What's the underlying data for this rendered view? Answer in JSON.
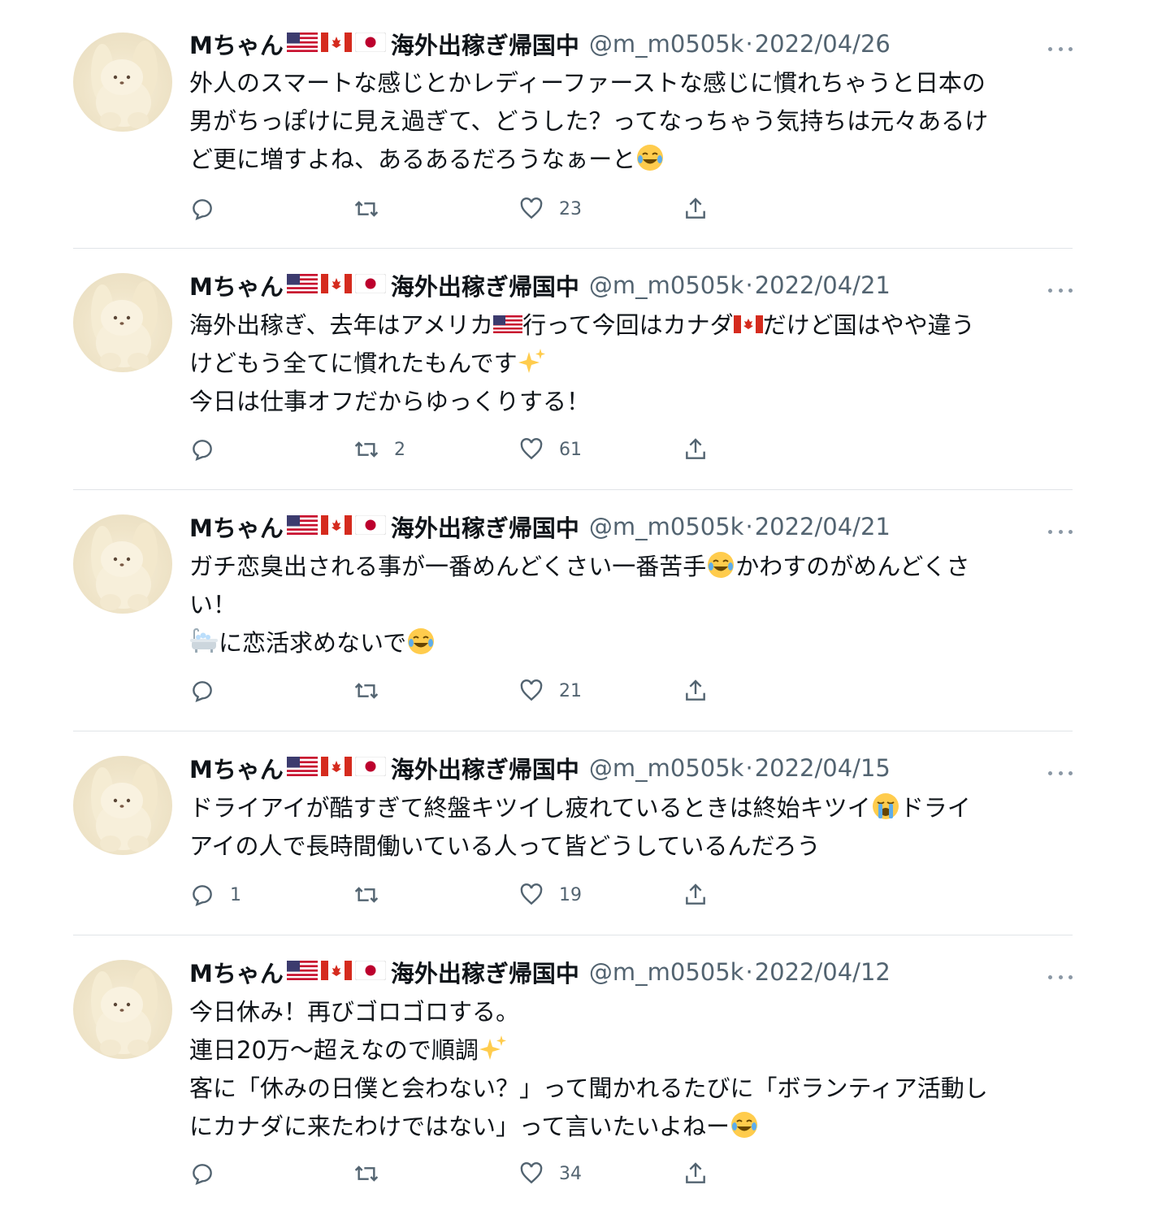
{
  "colors": {
    "text": "#0f1419",
    "secondary": "#536471",
    "divider": "#e1e4e8",
    "icon": "#536471"
  },
  "icons": {
    "reply": "speech-bubble-icon",
    "retweet": "retweet-icon",
    "like": "heart-icon",
    "share": "share-upload-icon",
    "more": "three-dots-icon",
    "flags": [
      "us-flag-icon",
      "canada-flag-icon",
      "japan-flag-icon"
    ]
  },
  "user": {
    "name_prefix": "Mちゃん",
    "name_suffix": "海外出稼ぎ帰国中",
    "handle": "@m_m0505k",
    "separator": "·"
  },
  "tweets": [
    {
      "date": "2022/04/26",
      "lines": [
        "外人のスマートな感じとかレディーファーストな感じに慣れちゃうと日本の",
        "男がちっぽけに見え過ぎて、どうした？ってなっちゃう気持ちは元々あるけ",
        "ど更に増すよね、あるあるだろうなぁーと"
      ],
      "reply_count": "",
      "retweet_count": "",
      "like_count": "23"
    },
    {
      "date": "2022/04/21",
      "lines": [
        "海外出稼ぎ、去年はアメリカ",
        "行って今回はカナダ",
        "だけど国はやや違う",
        "けどもう全てに慣れたもんです",
        "今日は仕事オフだからゆっくりする！"
      ],
      "reply_count": "",
      "retweet_count": "2",
      "like_count": "61"
    },
    {
      "date": "2022/04/21",
      "lines": [
        "ガチ恋臭出される事が一番めんどくさい一番苦手",
        "かわすのがめんどくさ",
        "い！",
        "に恋活求めないで"
      ],
      "reply_count": "",
      "retweet_count": "",
      "like_count": "21"
    },
    {
      "date": "2022/04/15",
      "lines": [
        "ドライアイが酷すぎて終盤キツイし疲れているときは終始キツイ",
        "ドライ",
        "アイの人で長時間働いている人って皆どうしているんだろう"
      ],
      "reply_count": "1",
      "retweet_count": "",
      "like_count": "19"
    },
    {
      "date": "2022/04/12",
      "lines": [
        "今日休み！再びゴロゴロする。",
        "連日20万〜超えなので順調",
        "客に「休みの日僕と会わない？」って聞かれるたびに「ボランティア活動し",
        "にカナダに来たわけではない」って言いたいよねー"
      ],
      "reply_count": "",
      "retweet_count": "",
      "like_count": "34"
    }
  ]
}
